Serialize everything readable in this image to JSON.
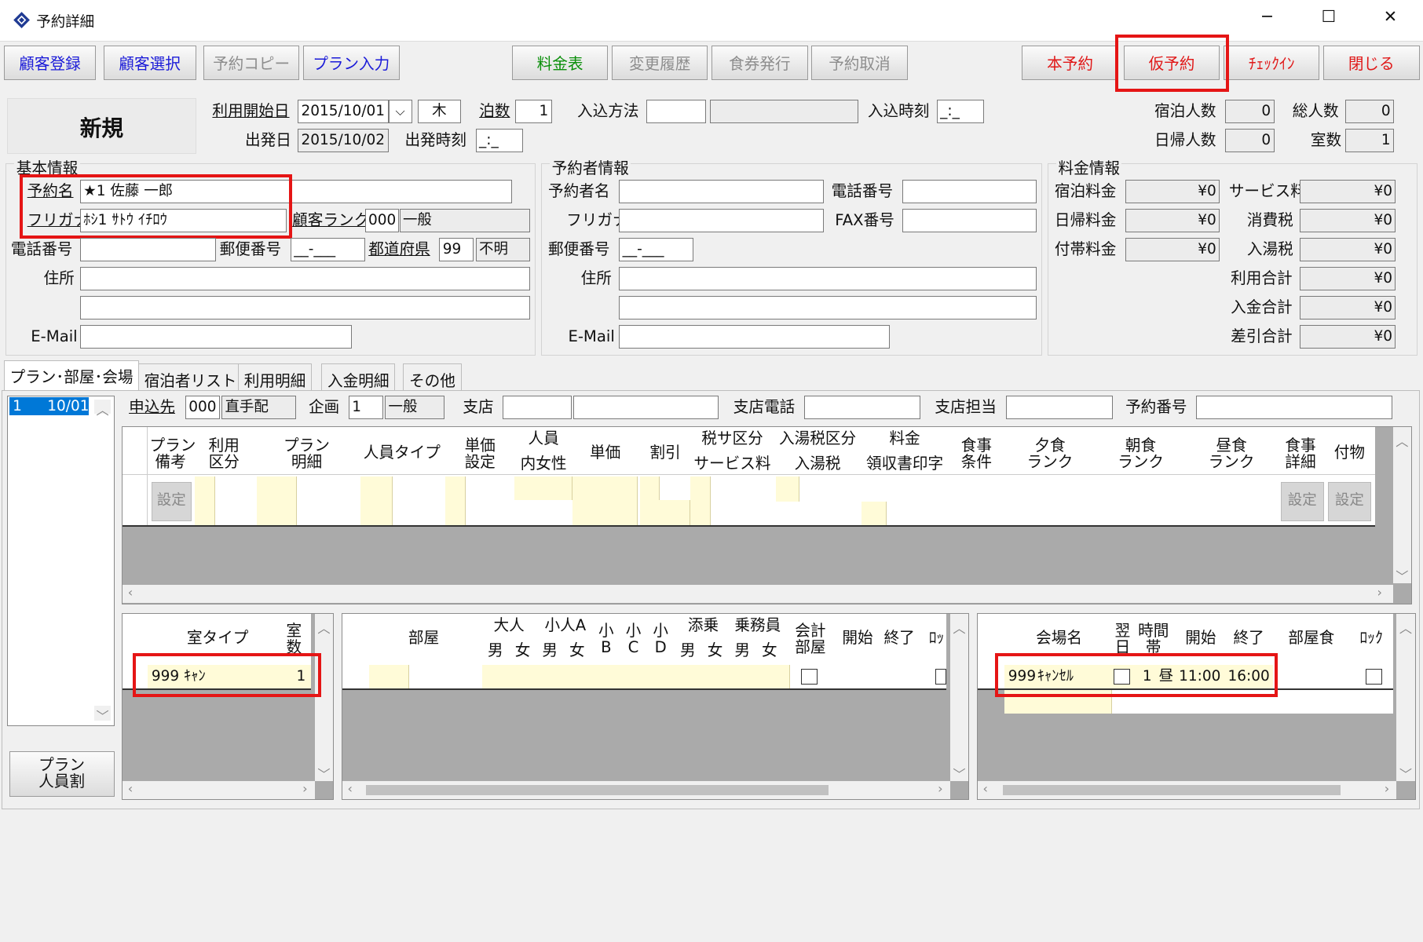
{
  "window": {
    "title": "予約詳細",
    "minimize": "─",
    "maximize": "☐",
    "close": "✕"
  },
  "toolbar": {
    "customer_register": "顧客登録",
    "customer_select": "顧客選択",
    "reservation_copy": "予約コピー",
    "plan_input": "プラン入力",
    "price_table": "料金表",
    "change_history": "変更履歴",
    "meal_ticket": "食券発行",
    "reservation_cancel": "予約取消",
    "main_reservation": "本予約",
    "temp_reservation": "仮予約",
    "checkin": "ﾁｪｯｸｲﾝ",
    "close": "閉じる"
  },
  "header": {
    "status": "新規",
    "start_date_label": "利用開始日",
    "start_date": "2015/10/01",
    "weekday": "木",
    "nights_label": "泊数",
    "nights": "1",
    "entry_method_label": "入込方法",
    "entry_time_label": "入込時刻",
    "entry_time": "_:_",
    "departure_label": "出発日",
    "departure": "2015/10/02",
    "departure_time_label": "出発時刻",
    "departure_time": "_:_",
    "stay_count_label": "宿泊人数",
    "stay_count": "0",
    "total_count_label": "総人数",
    "total_count": "0",
    "day_count_label": "日帰人数",
    "day_count": "0",
    "rooms_label": "室数",
    "rooms": "1"
  },
  "basic": {
    "group": "基本情報",
    "name_label": "予約名",
    "name": "★1 佐藤 一郎",
    "kana_label": "フリガナ",
    "kana": "ﾎｼ1 ｻﾄｳ ｲﾁﾛｳ",
    "rank_label": "顧客ランク",
    "rank_code": "000",
    "rank_name": "一般",
    "phone_label": "電話番号",
    "zip_label": "郵便番号",
    "zip": "__-___",
    "pref_label": "都道府県",
    "pref_code": "99",
    "pref_name": "不明",
    "addr_label": "住所",
    "email_label": "E-Mail"
  },
  "booker": {
    "group": "予約者情報",
    "name_label": "予約者名",
    "phone_label": "電話番号",
    "kana_label": "フリガナ",
    "fax_label": "FAX番号",
    "zip_label": "郵便番号",
    "zip": "__-___",
    "addr_label": "住所",
    "email_label": "E-Mail"
  },
  "fees": {
    "group": "料金情報",
    "stay_label": "宿泊料金",
    "stay": "¥0",
    "service_label": "サービス料",
    "service": "¥0",
    "day_label": "日帰料金",
    "day": "¥0",
    "tax_label": "消費税",
    "tax": "¥0",
    "extra_label": "付帯料金",
    "extra": "¥0",
    "bath_label": "入湯税",
    "bath": "¥0",
    "use_total_label": "利用合計",
    "use_total": "¥0",
    "paid_label": "入金合計",
    "paid": "¥0",
    "diff_label": "差引合計",
    "diff": "¥0"
  },
  "tabs": [
    "プラン･部屋･会場",
    "宿泊者リスト",
    "利用明細",
    "入金明細",
    "その他"
  ],
  "left_list": {
    "row": "1",
    "date": "10/01",
    "plan_button": "プラン\n人員割"
  },
  "plan_row": {
    "applicant_label": "申込先",
    "applicant_code": "000",
    "applicant_name": "直手配",
    "project_label": "企画",
    "project_code": "1",
    "project_name": "一般",
    "branch_label": "支店",
    "branch_phone_label": "支店電話",
    "branch_staff_label": "支店担当",
    "reservation_no_label": "予約番号"
  },
  "plan_grid": {
    "cols": [
      "プラン\n備考",
      "利用\n区分",
      "プラン\n明細",
      "人員タイプ",
      "単価\n設定",
      "人員",
      "内女性",
      "単価",
      "割引",
      "税サ区分",
      "サービス料",
      "入湯税区分",
      "入湯税",
      "料金",
      "領収書印字",
      "食事\n条件",
      "夕食\nランク",
      "朝食\nランク",
      "昼食\nランク",
      "食事\n詳細",
      "付物"
    ],
    "set_label": "設定"
  },
  "room_type_grid": {
    "col_type": "室タイプ",
    "col_count": "室\n数",
    "code": "999",
    "name": "ｷｬﾝ",
    "count": "1"
  },
  "room_grid": {
    "col_room": "部屋",
    "col_adult": "大人",
    "col_child_a": "小人A",
    "col_b": "小\nB",
    "col_c": "小\nC",
    "col_d": "小\nD",
    "col_attendant": "添乗",
    "col_crew": "乗務員",
    "col_account": "会計\n部屋",
    "col_start": "開始",
    "col_end": "終了",
    "col_lock": "ﾛｯ",
    "male": "男",
    "female": "女"
  },
  "venue_grid": {
    "col_name": "会場名",
    "col_next": "翌\n日",
    "col_slot": "時間\n帯",
    "col_start": "開始",
    "col_end": "終了",
    "col_meal": "部屋食",
    "col_lock": "ﾛｯｸ",
    "code": "999",
    "name": "ｷｬﾝｾﾙ",
    "slot_no": "1",
    "slot": "昼",
    "start": "11:00",
    "end": "16:00"
  },
  "colors": {
    "highlight": "#e51515",
    "input_yellow": "#fffbd8"
  }
}
